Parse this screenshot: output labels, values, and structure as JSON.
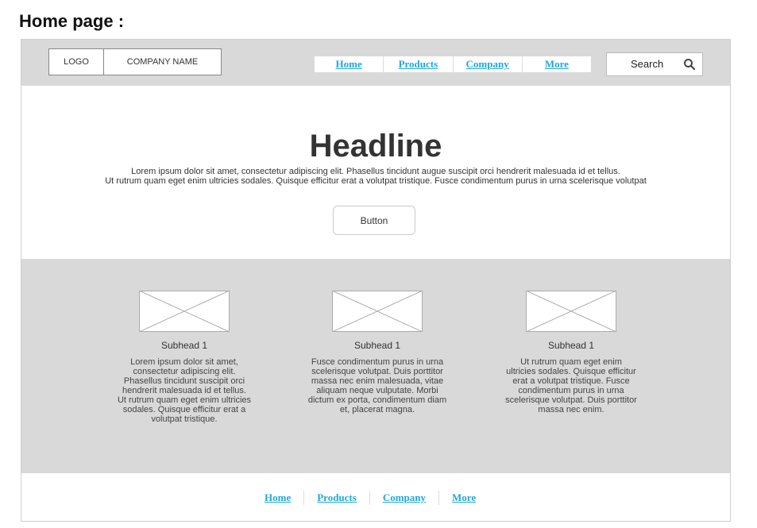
{
  "page_title": "Home page :",
  "header": {
    "logo": "LOGO",
    "company_name": "COMPANY NAME",
    "nav": [
      "Home",
      "Products",
      "Company",
      "More"
    ],
    "search_label": "Search"
  },
  "hero": {
    "headline": "Headline",
    "body_line1": "Lorem ipsum dolor sit amet, consectetur adipiscing elit. Phasellus tincidunt augue suscipit orci hendrerit malesuada id et tellus.",
    "body_line2": "Ut rutrum quam eget enim ultricies sodales. Quisque efficitur erat a volutpat tristique. Fusce condimentum purus in urna scelerisque volutpat",
    "button": "Button"
  },
  "features": [
    {
      "subhead": "Subhead 1",
      "lines": [
        "Lorem ipsum dolor sit amet,",
        "consectetur adipiscing elit.",
        "Phasellus tincidunt suscipit orci",
        "hendrerit malesuada id et tellus.",
        "Ut rutrum quam eget enim ultricies",
        "sodales. Quisque efficitur erat a",
        "volutpat tristique."
      ]
    },
    {
      "subhead": "Subhead 1",
      "lines": [
        "Fusce condimentum purus in urna",
        "scelerisque volutpat. Duis porttitor",
        "massa nec enim malesuada, vitae",
        "aliquam neque vulputate. Morbi",
        "dictum ex porta, condimentum diam",
        "et, placerat magna."
      ]
    },
    {
      "subhead": "Subhead 1",
      "lines": [
        "Ut rutrum quam eget enim",
        "ultricies sodales. Quisque efficitur",
        "erat a volutpat tristique. Fusce",
        "condimentum purus in urna",
        "scelerisque volutpat. Duis porttitor",
        "massa nec enim."
      ]
    }
  ],
  "footer": {
    "nav": [
      "Home",
      "Products",
      "Company",
      "More"
    ]
  },
  "colors": {
    "link": "#1fa8e0",
    "band": "#d9d9d9"
  },
  "icons": {
    "search": "search-icon",
    "image_placeholder": "image-placeholder-icon"
  }
}
